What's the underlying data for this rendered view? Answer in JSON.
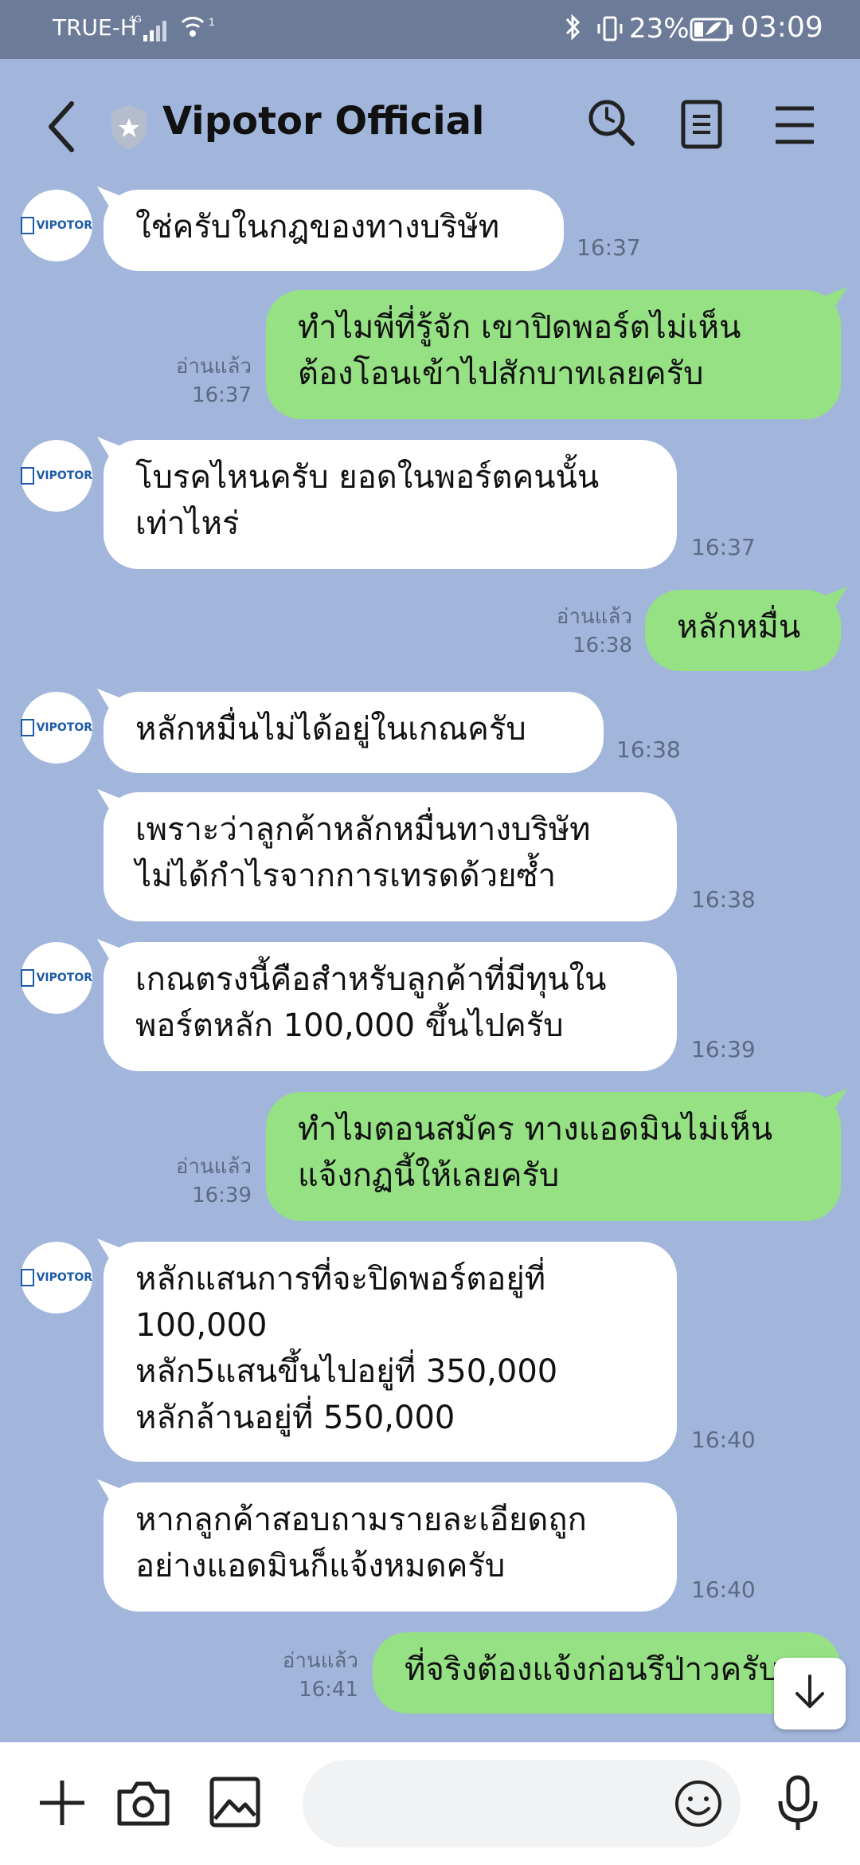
{
  "status_bar": {
    "carrier": "TRUE-H",
    "network": "4G",
    "hotspot_count": "1",
    "battery": "23%",
    "time": "03:09"
  },
  "header": {
    "title": "Vipotor Official",
    "icons": [
      "back-icon",
      "shield-icon",
      "search-icon",
      "notes-icon",
      "menu-icon"
    ]
  },
  "avatar_label": "VIPOTOR",
  "messages": [
    {
      "dir": "in",
      "text": "ใช่ครับในกฎของทางบริษัท",
      "time": "16:37"
    },
    {
      "dir": "out",
      "read": "อ่านแล้ว",
      "text": "ทำไมพี่ที่รู้จัก เขาปิดพอร์ตไม่เห็น\nต้องโอนเข้าไปสักบาทเลยครับ",
      "time": "16:37"
    },
    {
      "dir": "in",
      "text": "โบรคไหนครับ ยอดในพอร์ตคนนั้น\nเท่าไหร่",
      "time": "16:37"
    },
    {
      "dir": "out",
      "read": "อ่านแล้ว",
      "text": "หลักหมื่น",
      "time": "16:38"
    },
    {
      "dir": "in",
      "text": "หลักหมื่นไม่ได้อยู่ในเกณครับ",
      "time": "16:38"
    },
    {
      "dir": "in",
      "text": "เพราะว่าลูกค้าหลักหมื่นทางบริษัท\nไม่ได้กำไรจากการเทรดด้วยซ้ำ",
      "time": "16:38"
    },
    {
      "dir": "in",
      "text": "เกณตรงนี้คือสำหรับลูกค้าที่มีทุนใน\nพอร์ตหลัก 100,000 ขึ้นไปครับ",
      "time": "16:39"
    },
    {
      "dir": "out",
      "read": "อ่านแล้ว",
      "text": "ทำไมตอนสมัคร ทางแอดมินไม่เห็น\nแจ้งกฏนี้ให้เลยครับ",
      "time": "16:39"
    },
    {
      "dir": "in",
      "text": "หลักแสนการที่จะปิดพอร์ตอยู่ที่\n100,000\nหลัก5แสนขึ้นไปอยู่ที่  350,000\nหลักล้านอยู่ที่ 550,000",
      "time": "16:40"
    },
    {
      "dir": "in",
      "text": "หากลูกค้าสอบถามรายละเอียดถูก\nอย่างแอดมินก็แจ้งหมดครับ",
      "time": "16:40"
    },
    {
      "dir": "out",
      "read": "อ่านแล้ว",
      "text": "ที่จริงต้องแจ้งก่อนรึป่าวครับ",
      "time": "16:41"
    }
  ],
  "input_bar": {
    "icons": [
      "plus-icon",
      "camera-icon",
      "image-icon",
      "emoji-icon",
      "mic-icon"
    ],
    "placeholder": ""
  },
  "colors": {
    "background": "#a2b6dc",
    "status_bar": "#6c7b97",
    "incoming_bubble": "#ffffff",
    "outgoing_bubble": "#95e183"
  }
}
